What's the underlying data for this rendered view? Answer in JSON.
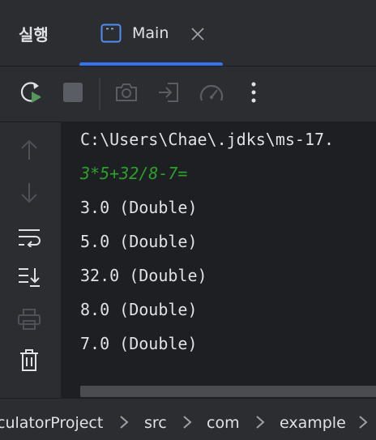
{
  "header": {
    "title": "실행",
    "tab": {
      "label": "Main",
      "icon": "console-window-icon"
    }
  },
  "toolbar": {
    "icons": [
      "rerun-icon",
      "stop-icon",
      "camera-icon",
      "import-icon",
      "profiler-gauge-icon",
      "more-vertical-icon"
    ]
  },
  "gutter": {
    "icons": [
      "up-arrow-icon",
      "down-arrow-icon",
      "soft-wrap-icon",
      "scroll-to-end-icon",
      "print-icon",
      "trash-icon"
    ]
  },
  "console": {
    "lines": [
      {
        "text": "C:\\Users\\Chae\\.jdks\\ms-17.",
        "type": "command"
      },
      {
        "text": "3*5+32/8-7=",
        "type": "input"
      },
      {
        "text": "3.0 (Double)",
        "type": "output"
      },
      {
        "text": "5.0 (Double)",
        "type": "output"
      },
      {
        "text": "32.0 (Double)",
        "type": "output"
      },
      {
        "text": "8.0 (Double)",
        "type": "output"
      },
      {
        "text": "7.0 (Double)",
        "type": "output"
      }
    ]
  },
  "breadcrumb": {
    "items": [
      "culatorProject",
      "src",
      "com",
      "example"
    ]
  },
  "colors": {
    "accent": "#3574f0",
    "input_text": "#2ba02b",
    "console_bg": "#1e1f22",
    "panel_bg": "#2b2d30"
  }
}
